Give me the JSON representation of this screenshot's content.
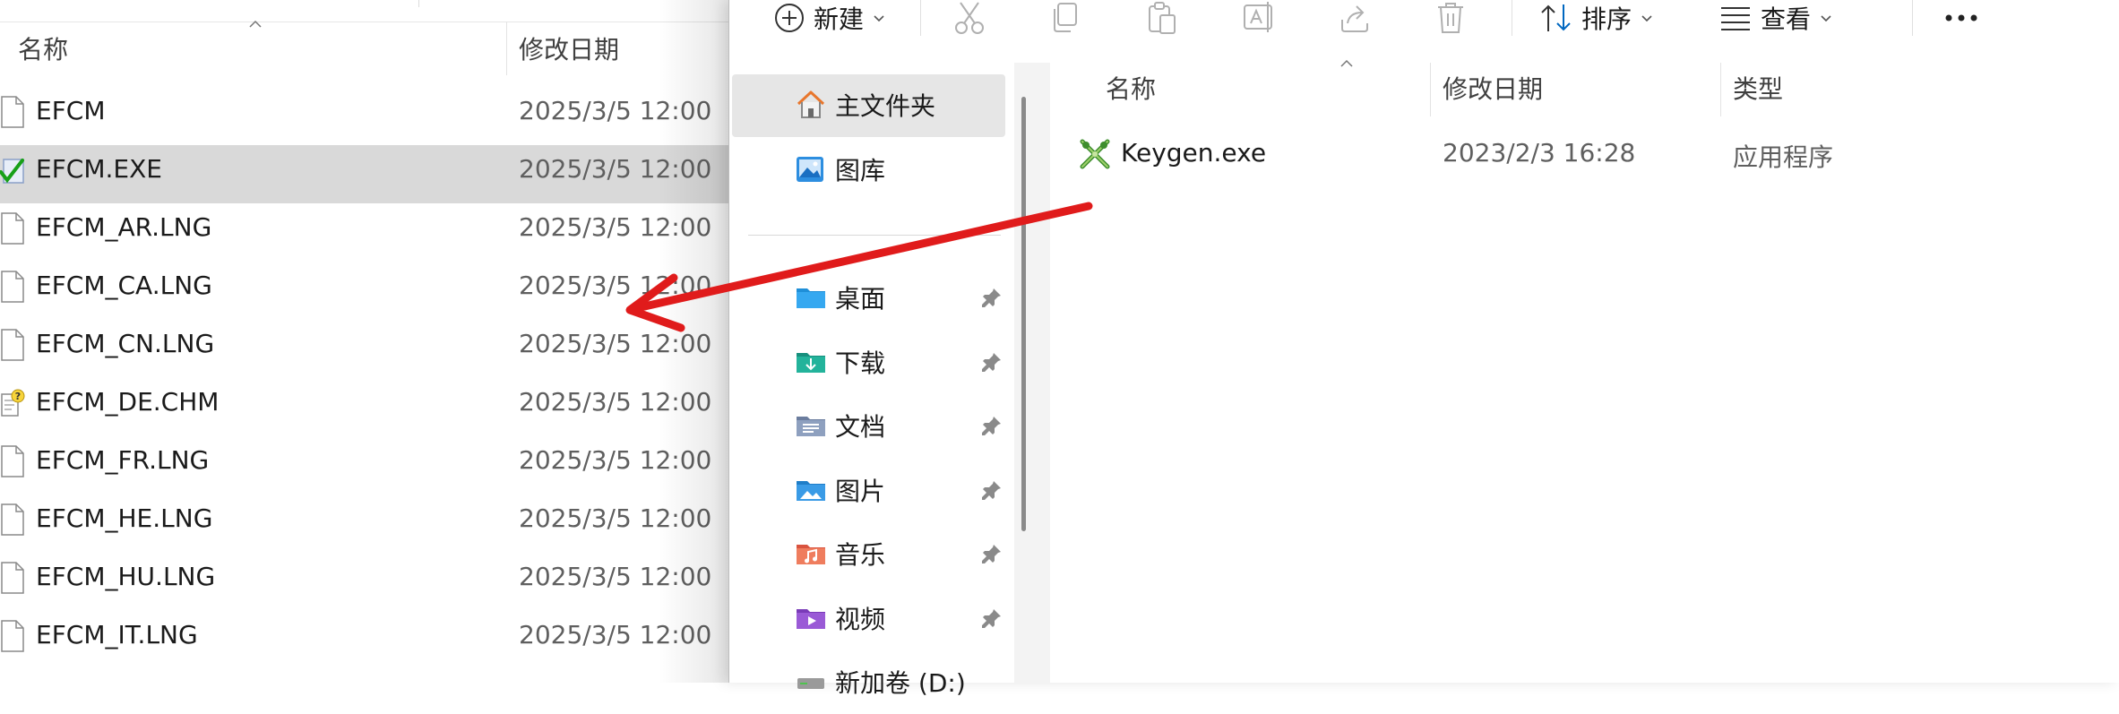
{
  "back_window": {
    "columns": {
      "name": "名称",
      "date": "修改日期"
    },
    "files": [
      {
        "name": "EFCM",
        "date": "2025/3/5 12:00",
        "icon": "file-icon"
      },
      {
        "name": "EFCM.EXE",
        "date": "2025/3/5 12:00",
        "icon": "exe-check-icon"
      },
      {
        "name": "EFCM_AR.LNG",
        "date": "2025/3/5 12:00",
        "icon": "file-icon"
      },
      {
        "name": "EFCM_CA.LNG",
        "date": "2025/3/5 12:00",
        "icon": "file-icon"
      },
      {
        "name": "EFCM_CN.LNG",
        "date": "2025/3/5 12:00",
        "icon": "file-icon"
      },
      {
        "name": "EFCM_DE.CHM",
        "date": "2025/3/5 12:00",
        "icon": "help-file-icon"
      },
      {
        "name": "EFCM_FR.LNG",
        "date": "2025/3/5 12:00",
        "icon": "file-icon"
      },
      {
        "name": "EFCM_HE.LNG",
        "date": "2025/3/5 12:00",
        "icon": "file-icon"
      },
      {
        "name": "EFCM_HU.LNG",
        "date": "2025/3/5 12:00",
        "icon": "file-icon"
      },
      {
        "name": "EFCM_IT.LNG",
        "date": "2025/3/5 12:00",
        "icon": "file-icon"
      }
    ],
    "selected_file": "EFCM.EXE"
  },
  "front_window": {
    "toolbar": {
      "new_label": "新建",
      "sort_label": "排序",
      "view_label": "查看",
      "more_label": "•••"
    },
    "nav": {
      "items": [
        {
          "label": "主文件夹",
          "icon": "home-icon",
          "active": true,
          "pinned": false
        },
        {
          "label": "图库",
          "icon": "gallery-icon",
          "active": false,
          "pinned": false
        },
        {
          "label": "桌面",
          "icon": "desktop-folder-icon",
          "active": false,
          "pinned": true
        },
        {
          "label": "下载",
          "icon": "downloads-folder-icon",
          "active": false,
          "pinned": true
        },
        {
          "label": "文档",
          "icon": "documents-folder-icon",
          "active": false,
          "pinned": true
        },
        {
          "label": "图片",
          "icon": "pictures-folder-icon",
          "active": false,
          "pinned": true
        },
        {
          "label": "音乐",
          "icon": "music-folder-icon",
          "active": false,
          "pinned": true
        },
        {
          "label": "视频",
          "icon": "videos-folder-icon",
          "active": false,
          "pinned": true
        },
        {
          "label": "新加卷 (D:)",
          "icon": "drive-icon",
          "active": false,
          "pinned": false
        }
      ]
    },
    "content": {
      "columns": {
        "name": "名称",
        "date": "修改日期",
        "type": "类型"
      },
      "files": [
        {
          "name": "Keygen.exe",
          "date": "2023/2/3 16:28",
          "type": "应用程序",
          "icon": "keygen-app-icon"
        }
      ]
    }
  },
  "annotation": {
    "arrow_color": "#e01b1b"
  },
  "colors": {
    "selection": "#d9d9d9",
    "nav_active": "#e6e6e6",
    "accent": "#0067c0"
  }
}
